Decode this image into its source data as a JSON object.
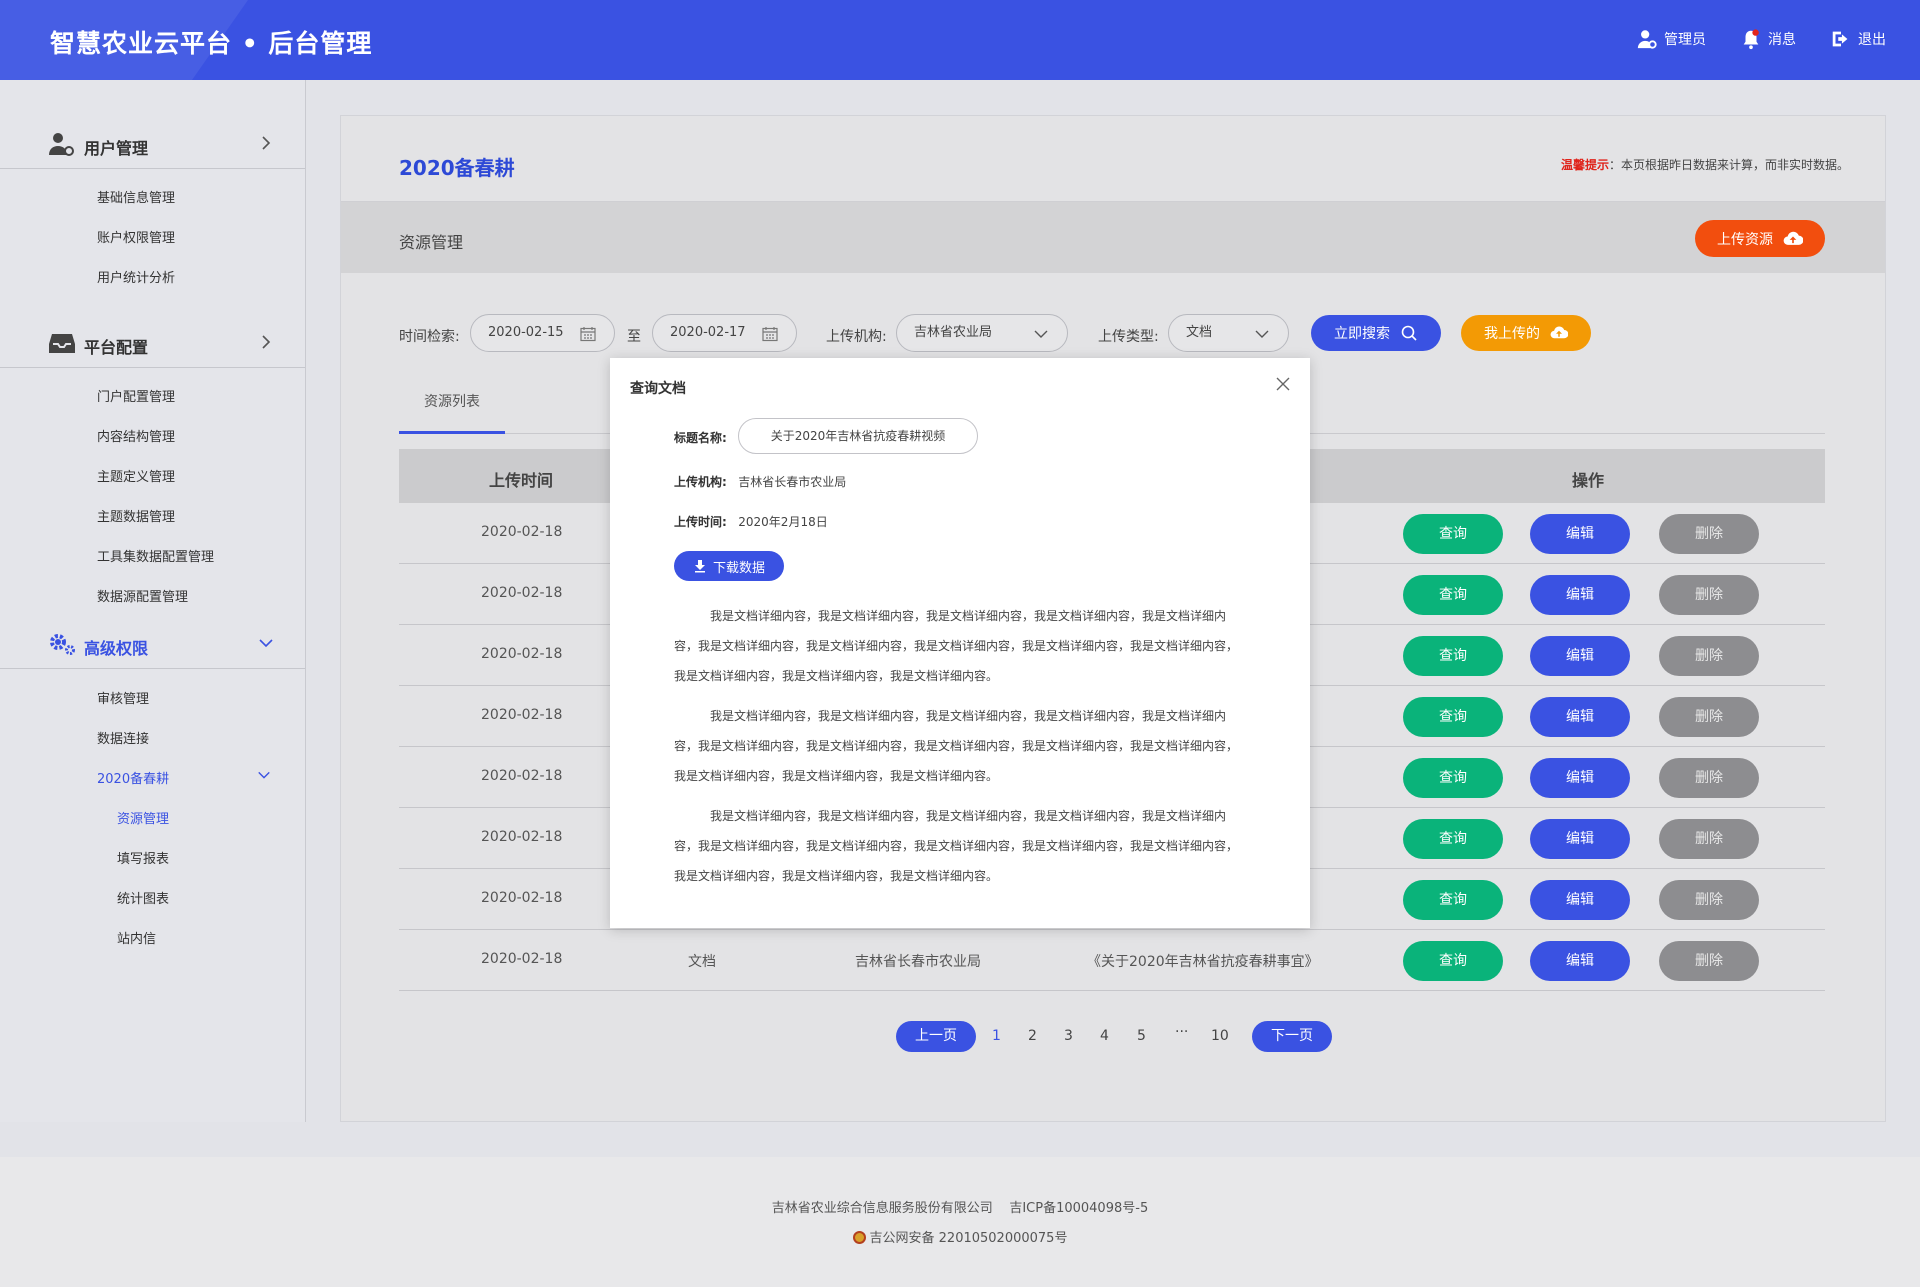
{
  "header": {
    "title": "智慧农业云平台 • 后台管理",
    "admin": "管理员",
    "messages": "消息",
    "logout": "退出"
  },
  "sidebar": {
    "groups": [
      {
        "label": "用户管理",
        "items": [
          "基础信息管理",
          "账户权限管理",
          "用户统计分析"
        ]
      },
      {
        "label": "平台配置",
        "items": [
          "门户配置管理",
          "内容结构管理",
          "主题定义管理",
          "主题数据管理",
          "工具集数据配置管理",
          "数据源配置管理"
        ]
      },
      {
        "label": "高级权限",
        "items": [
          "审核管理",
          "数据连接",
          "2020备春耕"
        ],
        "subitems": [
          "资源管理",
          "填写报表",
          "统计图表",
          "站内信"
        ]
      }
    ]
  },
  "main": {
    "title": "2020备春耕",
    "tip_label": "温馨提示",
    "tip_text": "：本页根据昨日数据来计算，而非实时数据。",
    "section": "资源管理",
    "upload_button": "上传资源",
    "filters": {
      "time_label": "时间检索:",
      "date_from": "2020-02-15",
      "to_label": "至",
      "date_to": "2020-02-17",
      "org_label": "上传机构:",
      "org_value": "吉林省农业局",
      "type_label": "上传类型:",
      "type_value": "文档",
      "search_button": "立即搜索",
      "mine_button": "我上传的"
    },
    "tab": "资源列表",
    "table": {
      "headers": {
        "time": "上传时间",
        "actions": "操作"
      },
      "rows": [
        {
          "time": "2020-02-18"
        },
        {
          "time": "2020-02-18"
        },
        {
          "time": "2020-02-18"
        },
        {
          "time": "2020-02-18"
        },
        {
          "time": "2020-02-18"
        },
        {
          "time": "2020-02-18"
        },
        {
          "time": "2020-02-18"
        },
        {
          "time": "2020-02-18",
          "type": "文档",
          "org": "吉林省长春市农业局",
          "title": "《关于2020年吉林省抗疫春耕事宜》"
        }
      ],
      "action_labels": {
        "query": "查询",
        "edit": "编辑",
        "delete": "删除"
      }
    },
    "pagination": {
      "prev": "上一页",
      "pages": [
        "1",
        "2",
        "3",
        "4",
        "5",
        "···",
        "10"
      ],
      "next": "下一页"
    }
  },
  "modal": {
    "title": "查询文档",
    "title_label": "标题名称:",
    "title_value": "关于2020年吉林省抗疫春耕视频",
    "org_label": "上传机构:",
    "org_value": "吉林省长春市农业局",
    "time_label": "上传时间:",
    "time_value": "2020年2月18日",
    "download_button": "下载数据",
    "paragraphs": [
      "我是文档详细内容，我是文档详细内容，我是文档详细内容，我是文档详细内容，我是文档详细内容，我是文档详细内容，我是文档详细内容，我是文档详细内容，我是文档详细内容，我是文档详细内容，我是文档详细内容，我是文档详细内容，我是文档详细内容。",
      "我是文档详细内容，我是文档详细内容，我是文档详细内容，我是文档详细内容，我是文档详细内容，我是文档详细内容，我是文档详细内容，我是文档详细内容，我是文档详细内容，我是文档详细内容，我是文档详细内容，我是文档详细内容，我是文档详细内容。",
      "我是文档详细内容，我是文档详细内容，我是文档详细内容，我是文档详细内容，我是文档详细内容，我是文档详细内容，我是文档详细内容，我是文档详细内容，我是文档详细内容，我是文档详细内容，我是文档详细内容，我是文档详细内容，我是文档详细内容。"
    ]
  },
  "footer": {
    "company": "吉林省农业综合信息服务股份有限公司",
    "icp": "吉ICP备10004098号-5",
    "police": "吉公网安备 22010502000075号"
  },
  "colors": {
    "primary": "#3a52e2",
    "success": "#0ab37a",
    "warning": "#f39a05",
    "danger": "#f24e0e",
    "muted": "#8d8d90"
  }
}
